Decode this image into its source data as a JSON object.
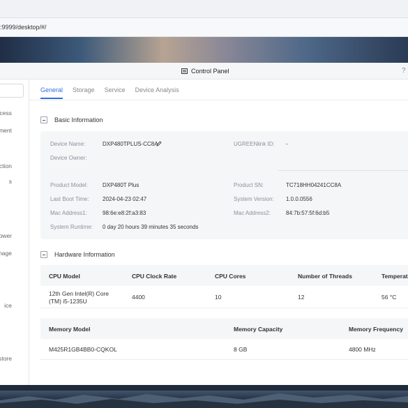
{
  "browser": {
    "url": ":9999/desktop/#/"
  },
  "window": {
    "title": "Control Panel",
    "help": "?"
  },
  "sidebar": {
    "items": [
      {
        "label": "cess"
      },
      {
        "label": "ment"
      },
      {
        "label": "ection"
      },
      {
        "label": "s"
      },
      {
        "label": "Power"
      },
      {
        "label": "nage"
      },
      {
        "label": "ice"
      },
      {
        "label": "store"
      }
    ]
  },
  "tabs": [
    {
      "label": "General",
      "active": true
    },
    {
      "label": "Storage",
      "active": false
    },
    {
      "label": "Service",
      "active": false
    },
    {
      "label": "Device Analysis",
      "active": false
    }
  ],
  "basic": {
    "title": "Basic Information",
    "device_name_label": "Device Name:",
    "device_name": "DXP480TPLUS-CC8A",
    "ugreenlink_label": "UGREENlink ID:",
    "ugreenlink": "-",
    "device_owner_label": "Device Owner:",
    "product_model_label": "Product Model:",
    "product_model": "DXP480T Plus",
    "product_sn_label": "Product SN:",
    "product_sn": "TC718HH04241CC8A",
    "last_boot_label": "Last Boot Time:",
    "last_boot": "2024-04-23 02:47",
    "system_version_label": "System Version:",
    "system_version": "1.0.0.0556",
    "mac1_label": "Mac Address1:",
    "mac1": "98:6e:e8:2f:a3:83",
    "mac2_label": "Mac Address2:",
    "mac2": "84:7b:57:5f:6d:b5",
    "runtime_label": "System Runtime:",
    "runtime": "0 day 20 hours 39 minutes 35 seconds"
  },
  "hardware": {
    "title": "Hardware Information",
    "cpu_headers": [
      "CPU Model",
      "CPU Clock Rate",
      "CPU Cores",
      "Number of Threads",
      "Temperatu"
    ],
    "cpu_row": {
      "model_line1": "12th Gen Intel(R) Core",
      "model_line2": "(TM) i5-1235U",
      "clock": "4400",
      "cores": "10",
      "threads": "12",
      "temp": "56 °C"
    },
    "mem_headers": [
      "Memory Model",
      "Memory Capacity",
      "Memory Frequency"
    ],
    "mem_row": {
      "model": "M425R1GB4BB0-CQKOL",
      "capacity": "8 GB",
      "frequency": "4800 MHz"
    }
  },
  "colors": {
    "accent": "#2f6fdc",
    "panel_bg": "#f5f6f8"
  }
}
